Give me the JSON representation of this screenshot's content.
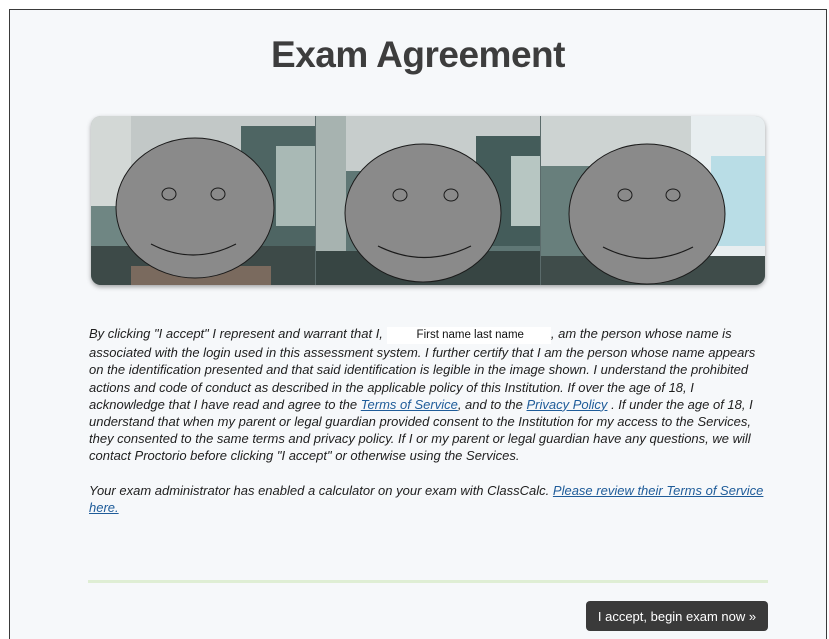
{
  "page": {
    "title": "Exam Agreement"
  },
  "agreement": {
    "p1_pre": "By clicking \"I accept\" I represent and warrant that I,",
    "user_name": "First name last name",
    "p1_mid": ", am the person whose name is associated with the login used in this assessment system. I further certify that I am the person whose name appears on the identification presented and that said identification is legible in the image shown. I understand the prohibited actions and code of conduct as described in the applicable policy of this Institution. If over the age of 18, I acknowledge that I have read and agree to the",
    "terms_link": "Terms of Service",
    "p1_and": ", and to the",
    "privacy_link": "Privacy Policy",
    "p1_post": ". If under the age of 18, I understand that when my parent or legal guardian provided consent to the Institution for my access to the Services, they consented to the same terms and privacy policy. If I or my parent or legal guardian have any questions, we will contact Proctorio before clicking \"I accept\" or otherwise using the Services.",
    "p2_text": "Your exam administrator has enabled a calculator on your exam with ClassCalc.",
    "p2_link": "Please review their Terms of Service here."
  },
  "actions": {
    "accept_label": "I accept, begin exam now »"
  },
  "colors": {
    "link": "#1f5c99",
    "button": "#3a3a3a",
    "divider": "#dfeed4",
    "title": "#3d3d3d"
  },
  "icons": [
    "smiley-face-icon"
  ]
}
